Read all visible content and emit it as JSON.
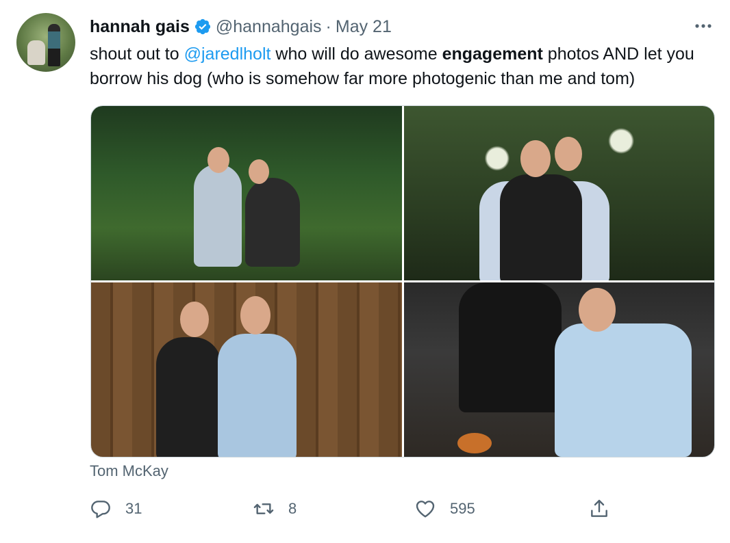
{
  "tweet": {
    "author_name": "hannah gais",
    "author_handle": "@hannahgais",
    "separator": "·",
    "date": "May 21",
    "text_parts": {
      "p1": "shout out to ",
      "mention": "@jaredlholt",
      "p2": " who will do awesome ",
      "bold": "engagement",
      "p3": " photos AND let you borrow his dog (who is somehow far more photogenic than me and tom)"
    },
    "media_caption": "Tom McKay"
  },
  "actions": {
    "reply_count": "31",
    "retweet_count": "8",
    "like_count": "595"
  },
  "icons": {
    "verified": "verified-badge-icon",
    "more": "more-options-icon",
    "reply": "reply-icon",
    "retweet": "retweet-icon",
    "like": "like-icon",
    "share": "share-icon"
  },
  "colors": {
    "accent": "#1d9bf0",
    "text": "#0f1419",
    "secondary": "#536471"
  }
}
